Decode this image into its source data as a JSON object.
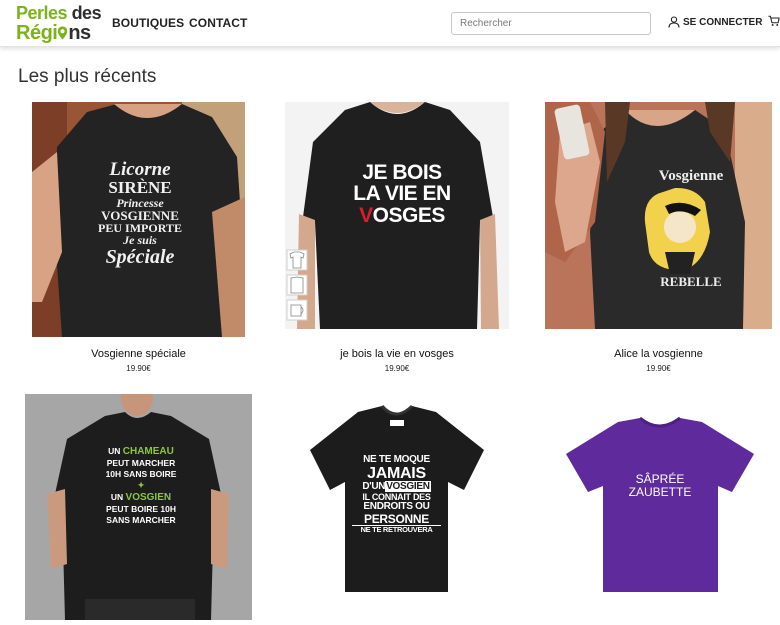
{
  "header": {
    "logo": {
      "line1_green": "Perles",
      "line1_dark": "des",
      "line2_green": "Régi",
      "line2_dark": "ns"
    },
    "nav": [
      {
        "label": "BOUTIQUES"
      },
      {
        "label": "CONTACT"
      }
    ],
    "search": {
      "placeholder": "Rechercher",
      "value": ""
    },
    "login_label": "SE CONNECTER"
  },
  "section": {
    "title": "Les plus récents"
  },
  "products": [
    {
      "name": "Vosgienne spéciale",
      "price": "19.90€",
      "shirt_lines": [
        "Licorne",
        "SIRÈNE",
        "Princesse",
        "VOSGIENNE",
        "PEU IMPORTE",
        "Je suis",
        "Spéciale"
      ]
    },
    {
      "name": "je bois la vie en vosges",
      "price": "19.90€",
      "shirt_lines": [
        "JE BOIS",
        "LA VIE EN",
        "V",
        "OSGES"
      ]
    },
    {
      "name": "Alice la vosgienne",
      "price": "19.90€",
      "shirt_lines": [
        "Vosgienne",
        "REBELLE"
      ]
    },
    {
      "shirt_lines": [
        "UN",
        "CHAMEAU",
        "PEUT MARCHER",
        "10H SANS BOIRE",
        "UN",
        "VOSGIEN",
        "PEUT BOIRE 10H",
        "SANS MARCHER"
      ]
    },
    {
      "shirt_lines": [
        "NE TE MOQUE",
        "JAMAIS",
        "D'UN",
        "VOSGIEN",
        "IL CONNAIT DES",
        "ENDROITS OU",
        "PERSONNE",
        "NE TE RETROUVERA"
      ]
    },
    {
      "shirt_lines": [
        "SÂPRÉE",
        "ZAUBETTE"
      ]
    }
  ],
  "colors": {
    "brand_green": "#7bb31a",
    "shirt_black": "#1b1b1b",
    "shirt_purple": "#5f2a9c",
    "vosges_red": "#d81e2a"
  }
}
